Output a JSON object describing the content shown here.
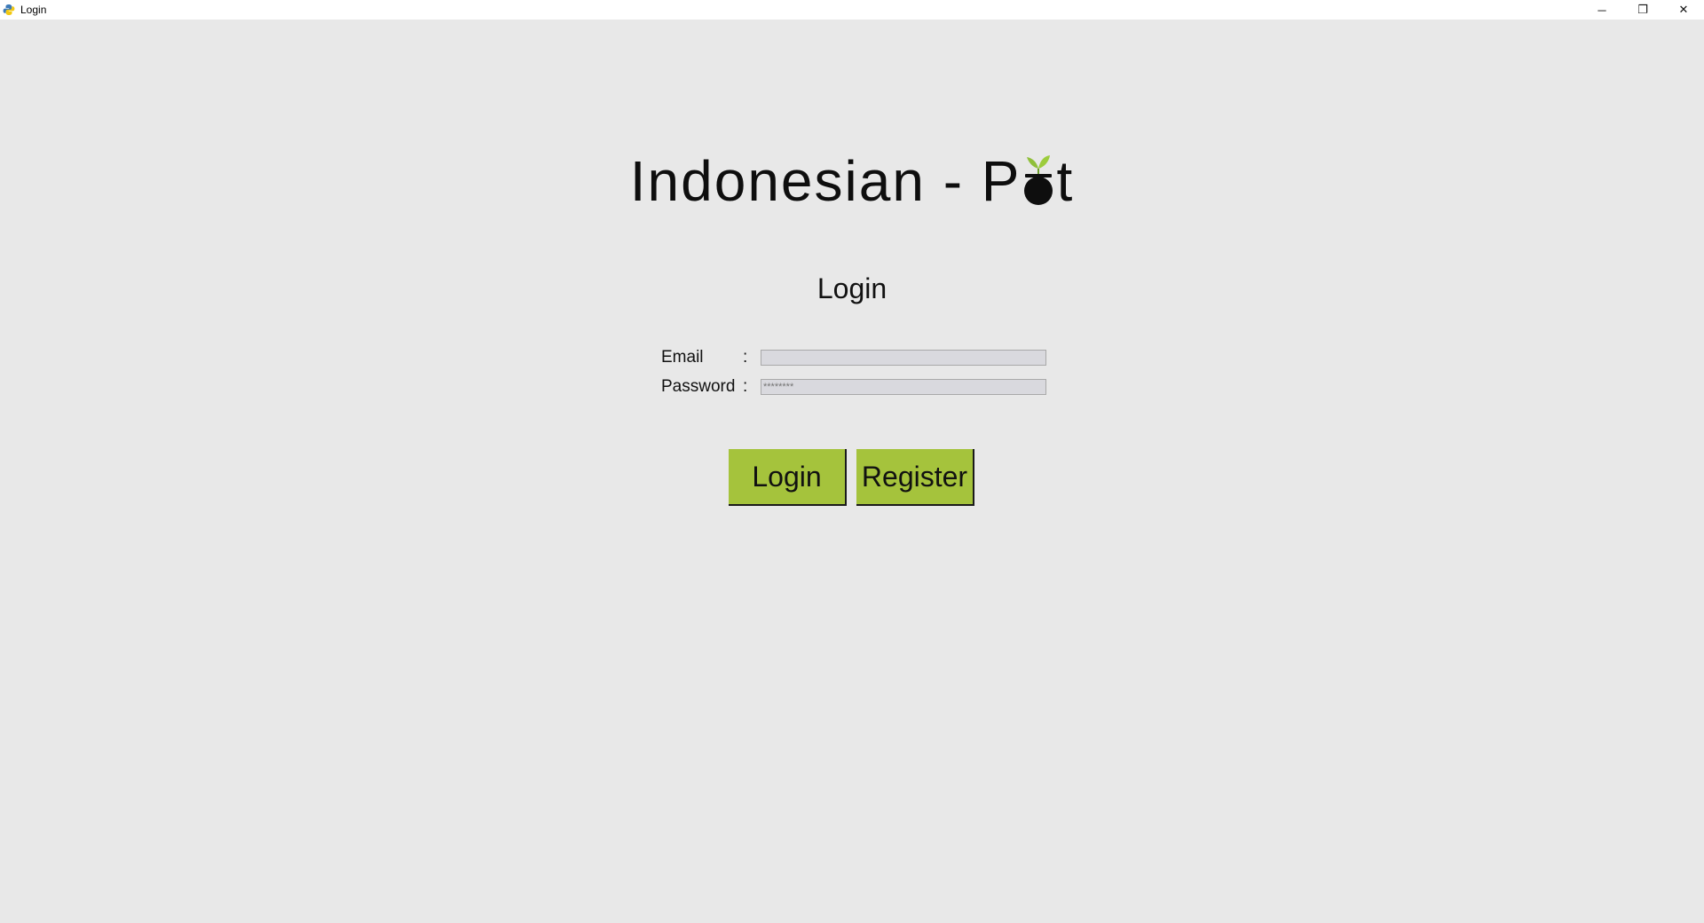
{
  "window": {
    "title": "Login",
    "controls": {
      "minimize": "─",
      "restore": "❐",
      "close": "✕"
    }
  },
  "logo": {
    "text_before": "Indonesian - P",
    "text_after": "t",
    "leaf_color": "#8fbf3a",
    "pot_color": "#0e0e0e"
  },
  "heading": "Login",
  "form": {
    "email": {
      "label": "Email",
      "separator": ":",
      "value": ""
    },
    "password": {
      "label": "Password",
      "separator": ":",
      "placeholder": "********"
    }
  },
  "buttons": {
    "login": "Login",
    "register": "Register"
  },
  "colors": {
    "button_bg": "#a5c33c",
    "window_bg": "#e8e8e8"
  }
}
